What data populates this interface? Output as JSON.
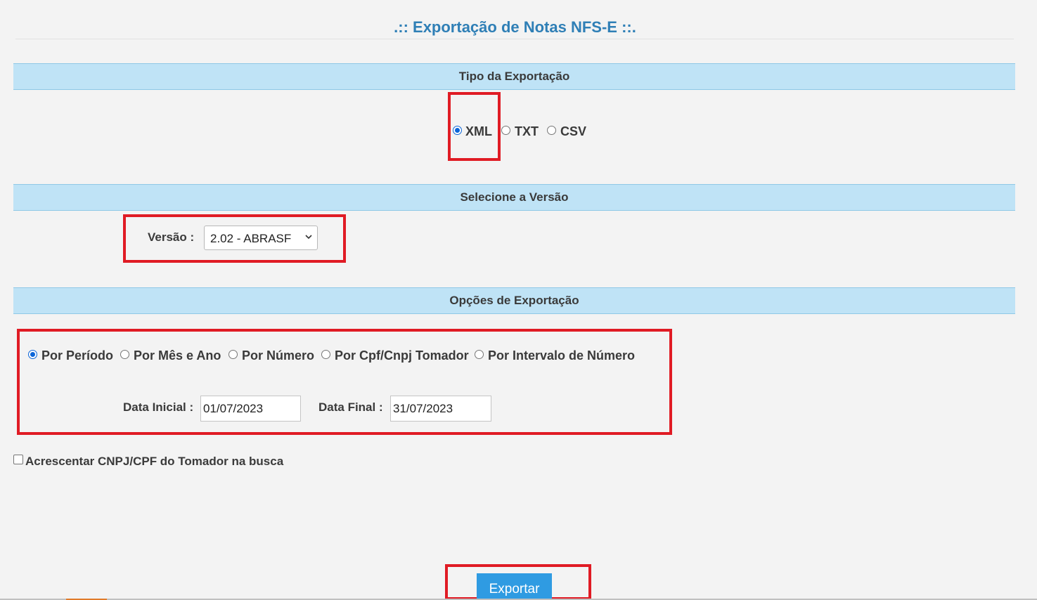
{
  "page": {
    "title": ".:: Exportação de Notas NFS-E ::."
  },
  "sections": {
    "tipo": {
      "title": "Tipo da Exportação"
    },
    "versao": {
      "title": "Selecione a Versão"
    },
    "opcoes": {
      "title": "Opções de Exportação"
    }
  },
  "export_type": {
    "options": [
      {
        "label": "XML",
        "checked": true
      },
      {
        "label": "TXT",
        "checked": false
      },
      {
        "label": "CSV",
        "checked": false
      }
    ]
  },
  "version": {
    "label": "Versão :",
    "selected": "2.02 - ABRASF"
  },
  "export_options": {
    "modes": [
      {
        "label": "Por Período",
        "checked": true
      },
      {
        "label": "Por Mês e Ano",
        "checked": false
      },
      {
        "label": "Por Número",
        "checked": false
      },
      {
        "label": "Por Cpf/Cnpj Tomador",
        "checked": false
      },
      {
        "label": "Por Intervalo de Número",
        "checked": false
      }
    ],
    "start_date": {
      "label": "Data Inicial :",
      "value": "01/07/2023"
    },
    "end_date": {
      "label": "Data Final :",
      "value": "31/07/2023"
    }
  },
  "add_cnpj": {
    "label": "Acrescentar CNPJ/CPF do Tomador na busca",
    "checked": false
  },
  "export_button": {
    "label": "Exportar"
  },
  "colors": {
    "title": "#2f7fb6",
    "section_header": "#bfe3f6",
    "highlight_box": "#e01b24",
    "button": "#2f9be2",
    "radio_selected": "#0b65d8"
  }
}
